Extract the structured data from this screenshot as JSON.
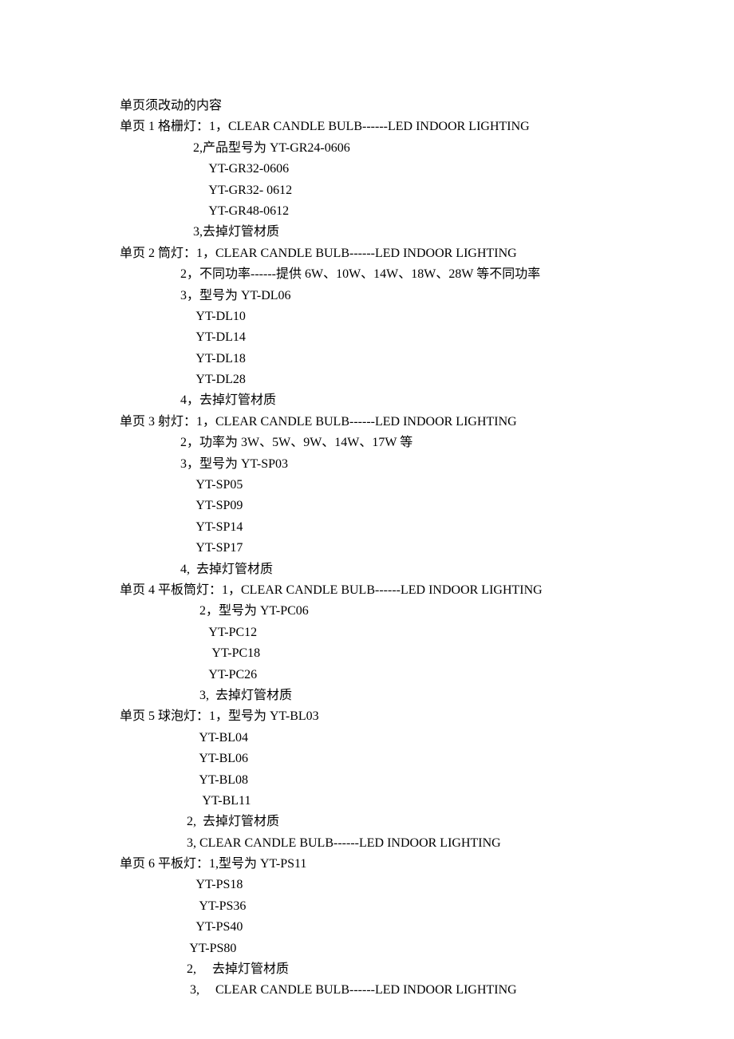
{
  "lines": [
    "单页须改动的内容",
    "单页 1 格栅灯：1，CLEAR CANDLE BULB------LED INDOOR LIGHTING",
    "                       2,产品型号为 YT-GR24-0606",
    "                            YT-GR32-0606",
    "                            YT-GR32- 0612",
    "                            YT-GR48-0612",
    "                       3,去掉灯管材质",
    "单页 2 筒灯：1，CLEAR CANDLE BULB------LED INDOOR LIGHTING",
    "                   2，不同功率------提供 6W、10W、14W、18W、28W 等不同功率",
    "                   3，型号为 YT-DL06",
    "                        YT-DL10",
    "                        YT-DL14",
    "                        YT-DL18",
    "                        YT-DL28",
    "                   4，去掉灯管材质",
    "单页 3 射灯：1，CLEAR CANDLE BULB------LED INDOOR LIGHTING",
    "                   2，功率为 3W、5W、9W、14W、17W 等",
    "                   3，型号为 YT-SP03",
    "                        YT-SP05",
    "                        YT-SP09",
    "                        YT-SP14",
    "                        YT-SP17",
    "                   4,  去掉灯管材质",
    "单页 4 平板筒灯：1，CLEAR CANDLE BULB------LED INDOOR LIGHTING",
    "                         2，型号为 YT-PC06",
    "                            YT-PC12",
    "                             YT-PC18",
    "                            YT-PC26",
    "                         3,  去掉灯管材质",
    "单页 5 球泡灯：1，型号为 YT-BL03",
    "                         YT-BL04",
    "                         YT-BL06",
    "                         YT-BL08",
    "                          YT-BL11",
    "                     2,  去掉灯管材质",
    "                     3, CLEAR CANDLE BULB------LED INDOOR LIGHTING",
    "单页 6 平板灯：1,型号为 YT-PS11",
    "                        YT-PS18",
    "                         YT-PS36",
    "                        YT-PS40",
    "                      YT-PS80",
    "                     2,     去掉灯管材质",
    "                      3,     CLEAR CANDLE BULB------LED INDOOR LIGHTING"
  ]
}
